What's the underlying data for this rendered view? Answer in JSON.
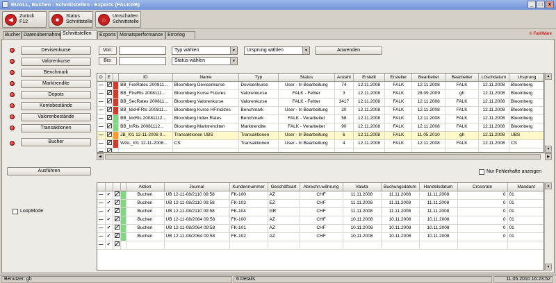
{
  "window": {
    "title": "BUALL, Buchen - Schnittstellen - Exports    (FALKDB)"
  },
  "toolbar": {
    "buttons": [
      {
        "line1": "Zurück",
        "line2": "F12"
      },
      {
        "line1": "Status",
        "line2": "Schnittstelle"
      },
      {
        "line1": "Umschalten",
        "line2": "Schnittstelle"
      }
    ]
  },
  "tabs": [
    "Bucher",
    "Datenübernahme",
    "Schnittstellen",
    "Exports",
    "Monatsperformance",
    "Errorlog"
  ],
  "brand": "© FalkWare",
  "left_buttons": [
    "Devisenkurse",
    "Valorenkurse",
    "Benchmark",
    "Marktrendite",
    "Depots",
    "Kontobestände",
    "Valorenbestände",
    "Transaktionen"
  ],
  "bucher_button": "Bucher",
  "execute_button": "Ausführen",
  "loopmode_label": "LoopMode",
  "filters": {
    "von_label": "Von:",
    "bis_label": "Bis:",
    "typ_select": "Typ wählen",
    "status_select": "Status wählen",
    "ursprung_select": "Ursprung wählen",
    "apply_button": "Anwenden"
  },
  "upper_grid": {
    "columns": [
      "D",
      "E",
      "",
      "ID",
      "Name",
      "Typ",
      "Status",
      "Anzahl",
      "Erstellt",
      "Ersteller",
      "Bearbeitet",
      "Bearbeiter",
      "Löschdatum",
      "Ursprung"
    ],
    "rows": [
      {
        "color": "red",
        "id": "BB_FexRates 200811...",
        "name": "Bloomberg Devisenkurse",
        "typ": "Devisenkurse",
        "status": "User - In Bearbeitung",
        "anzahl": "74",
        "erstellt": "12.11.2008",
        "ersteller": "FALK",
        "bearbeitet": "12.11.2008",
        "bearbeiter": "FALK",
        "loeschdatum": "12.11.2008",
        "ursprung": "Bloomberg"
      },
      {
        "color": "red",
        "id": "BB_FtreRts 2008111...",
        "name": "Bloomberg Kurse Futures",
        "typ": "Valorenkurse",
        "status": "FALK - Fehler",
        "anzahl": "3",
        "erstellt": "12.11.2008",
        "ersteller": "FALK",
        "bearbeitet": "28.09.2009",
        "bearbeiter": "gh",
        "loeschdatum": "12.11.2008",
        "ursprung": "Bloomberg"
      },
      {
        "color": "red",
        "id": "BB_SecRates 200811...",
        "name": "Bloomberg Valorenkurse",
        "typ": "Valorenkurse",
        "status": "FALK - Fehler",
        "anzahl": "3417",
        "erstellt": "12.11.2008",
        "ersteller": "FALK",
        "bearbeitet": "12.11.2008",
        "bearbeiter": "FALK",
        "loeschdatum": "12.11.2008",
        "ursprung": "Bloomberg"
      },
      {
        "color": "red",
        "id": "BB_IdxHFRts 200811...",
        "name": "Bloomberg Kurse HFIndizes",
        "typ": "Benchmark",
        "status": "User - In Bearbeitung",
        "anzahl": "20",
        "erstellt": "12.11.2008",
        "ersteller": "FALK",
        "bearbeitet": "12.11.2008",
        "bearbeiter": "FALK",
        "loeschdatum": "12.11.2008",
        "ursprung": "Bloomberg"
      },
      {
        "color": "green",
        "id": "BB_IdxRts 20081112...",
        "name": "Bloomberg Index Rates",
        "typ": "Benchmark",
        "status": "FALK - Verarbeitet",
        "anzahl": "58",
        "erstellt": "12.11.2008",
        "ersteller": "FALK",
        "bearbeitet": "12.11.2008",
        "bearbeiter": "FALK",
        "loeschdatum": "12.11.2008",
        "ursprung": "Bloomberg"
      },
      {
        "color": "green",
        "id": "BB_InRts 20081112...",
        "name": "Bloomberg Marktrenditen",
        "typ": "Marktrendite",
        "status": "FALK - Verarbeitet",
        "anzahl": "90",
        "erstellt": "12.11.2008",
        "ersteller": "FALK",
        "bearbeitet": "12.11.2008",
        "bearbeiter": "FALK",
        "loeschdatum": "12.11.2008",
        "ursprung": "Bloomberg"
      },
      {
        "color": "orange",
        "highlight": true,
        "id": "JB_I01 12-11-2008 0...",
        "name": "Transaktionen UBS",
        "typ": "Transaktionen",
        "status": "User - In Bearbeitung",
        "anzahl": "6",
        "erstellt": "12.11.2008",
        "ersteller": "FALK",
        "bearbeitet": "11.05.2010",
        "bearbeiter": "gh",
        "loeschdatum": "12.11.2008",
        "ursprung": "UBS"
      },
      {
        "color": "red",
        "id": "WGL_I01 12-11-2008...",
        "name": "CS",
        "typ": "Transaktionen",
        "status": "User - In Bearbeitung",
        "anzahl": "4",
        "erstellt": "12.11.2008",
        "ersteller": "FALK",
        "bearbeitet": "12.11.2008",
        "bearbeiter": "FALK",
        "loeschdatum": "12.11.2008",
        "ursprung": "CS"
      }
    ]
  },
  "error_filter_label": "Nur Fehlerhafte anzeigen",
  "lower_grid": {
    "columns": [
      "",
      "",
      "",
      "",
      "Aktion",
      "Journal",
      "Kundennummer",
      "Geschäftsart",
      "Abrechn.währung",
      "Valuta",
      "Buchungsdatum",
      "Handelsdatum",
      "Crossrate",
      "Mandant"
    ],
    "rows": [
      {
        "aktion": "Buchen",
        "journal": "UB 12-11-08/2110 09:58",
        "kunde": "FK-100",
        "art": "AZ",
        "waehrung": "CHF",
        "valuta": "11.11.2008",
        "buchung": "11.11.2008",
        "handel": "11.11.2008",
        "cross": "0",
        "mandant": "01"
      },
      {
        "aktion": "Buchen",
        "journal": "UB 12-11-08/2110 09:58",
        "kunde": "FK-103",
        "art": "EZ",
        "waehrung": "CHF",
        "valuta": "11.11.2008",
        "buchung": "11.11.2008",
        "handel": "11.11.2008",
        "cross": "0",
        "mandant": "01"
      },
      {
        "aktion": "Buchen",
        "journal": "UB 12-11-08/2110 09:58",
        "kunde": "FK-104",
        "art": "GR",
        "waehrung": "CHF",
        "valuta": "11.11.2008",
        "buchung": "11.11.2008",
        "handel": "11.11.2008",
        "cross": "0",
        "mandant": "01"
      },
      {
        "aktion": "Buchen",
        "journal": "UB 12-11-08/2064 09:58",
        "kunde": "FK-100",
        "art": "AZ",
        "waehrung": "CHF",
        "valuta": "10.11.2008",
        "buchung": "10.11.2008",
        "handel": "10.11.2008",
        "cross": "0",
        "mandant": "01"
      },
      {
        "aktion": "Buchen",
        "journal": "UB 12-11-08/2064 09:58",
        "kunde": "FK-101",
        "art": "AZ",
        "waehrung": "CHF",
        "valuta": "10.11.2008",
        "buchung": "10.11.2008",
        "handel": "10.11.2008",
        "cross": "0",
        "mandant": "01"
      },
      {
        "aktion": "Buchen",
        "journal": "UB 12-11-08/2064 09:58",
        "kunde": "FK-102",
        "art": "AZ",
        "waehrung": "CHF",
        "valuta": "10.11.2008",
        "buchung": "10.11.2008",
        "handel": "10.11.2008",
        "cross": "0",
        "mandant": "01"
      }
    ]
  },
  "statusbar": {
    "user": "Benutzer: gh",
    "details": "6 Details",
    "timestamp": "11.05.2010 16:23:52"
  },
  "colors": {
    "status_red": "#d23a2a",
    "status_green": "#7fd87f",
    "status_orange": "#ff9a2a",
    "highlight_row": "#fff8c8"
  }
}
